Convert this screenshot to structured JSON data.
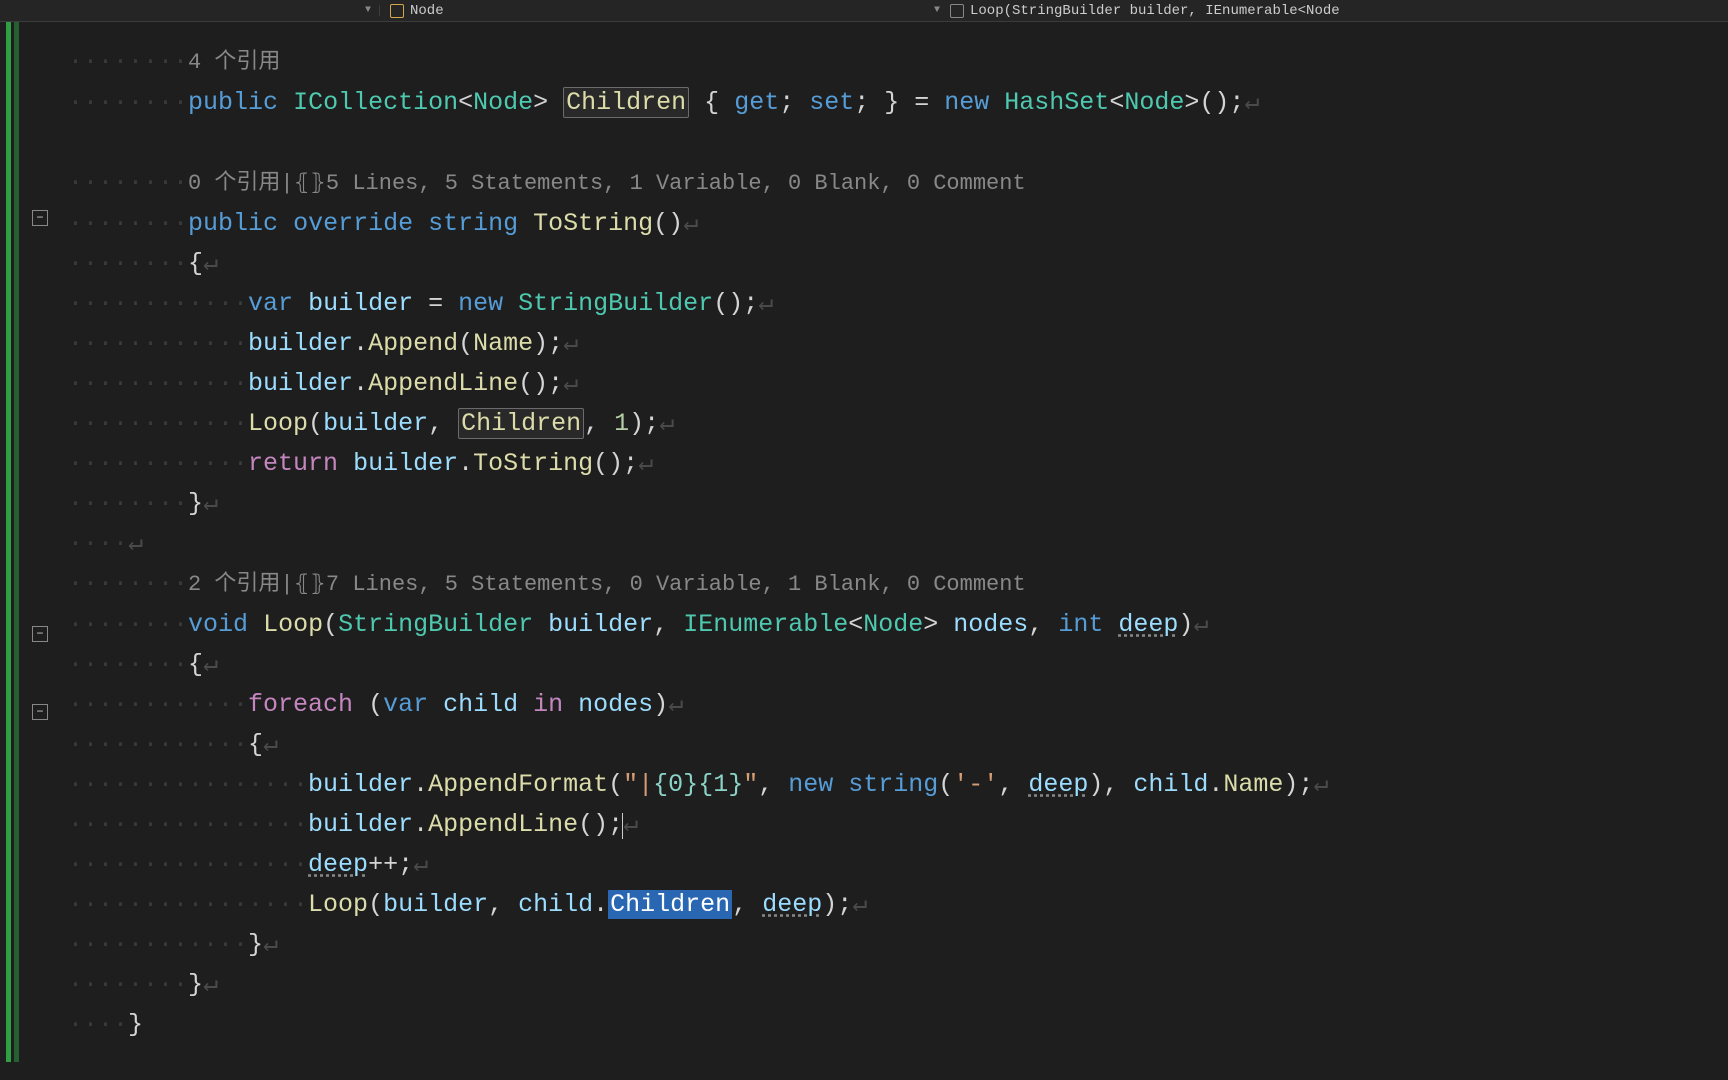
{
  "topbar": {
    "left_dropdown_hint": "▼",
    "mid_icon": "class",
    "mid_label": "Node",
    "right_label": "Loop(StringBuilder builder, IEnumerable<Node"
  },
  "fold": {
    "minus": "−"
  },
  "codelens": {
    "children": "4 个引用",
    "tostring": "0 个引用|⦃⦄5 Lines, 5 Statements, 1 Variable, 0 Blank, 0 Comment",
    "loop": "2 个引用|⦃⦄7 Lines, 5 Statements, 0 Variable, 1 Blank, 0 Comment"
  },
  "code": {
    "children_decl": {
      "public": "public",
      "icollection": "ICollection",
      "node": "Node",
      "children": "Children",
      "get": "get",
      "set": "set",
      "new": "new",
      "hashset": "HashSet"
    },
    "tostring_sig": {
      "public": "public",
      "override": "override",
      "string": "string",
      "tostring": "ToString"
    },
    "tostring_body": {
      "var": "var",
      "builder": "builder",
      "new": "new",
      "sb": "StringBuilder",
      "append": "Append",
      "name": "Name",
      "appendline": "AppendLine",
      "loop": "Loop",
      "children": "Children",
      "one": "1",
      "return": "return",
      "tostring": "ToString"
    },
    "loop_sig": {
      "void": "void",
      "loop": "Loop",
      "sb": "StringBuilder",
      "builder": "builder",
      "ienum": "IEnumerable",
      "node": "Node",
      "nodes": "nodes",
      "int": "int",
      "deep": "deep"
    },
    "loop_body": {
      "foreach": "foreach",
      "var": "var",
      "child": "child",
      "in": "in",
      "nodes": "nodes",
      "builder": "builder",
      "appendformat": "AppendFormat",
      "fmt_open": "\"",
      "fmt_pipe": "|",
      "fmt_brace0": "{0}",
      "fmt_brace1": "{1}",
      "fmt_close": "\"",
      "new": "new",
      "string": "string",
      "dash": "'-'",
      "deep": "deep",
      "childname": "child.Name",
      "appendline": "AppendLine",
      "deeppp": "deep",
      "pp": "++",
      "loop": "Loop",
      "childdot": "child",
      "children": "Children"
    }
  },
  "ws_dot": "·"
}
